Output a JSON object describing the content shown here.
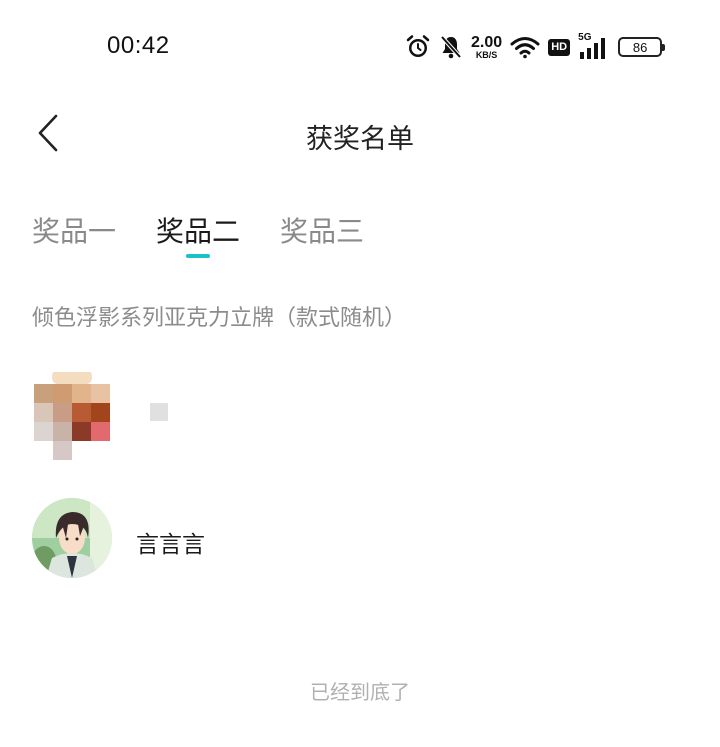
{
  "status_bar": {
    "time": "00:42",
    "net_speed": "2.00",
    "net_speed_unit": "KB/S",
    "hd_label": "HD",
    "signal_label": "5G",
    "battery": "86"
  },
  "nav": {
    "title": "获奖名单"
  },
  "tabs": [
    {
      "label": "奖品一",
      "active": false
    },
    {
      "label": "奖品二",
      "active": true
    },
    {
      "label": "奖品三",
      "active": false
    }
  ],
  "prize": {
    "name": "倾色浮影系列亚克力立牌（款式随机）"
  },
  "winners": [
    {
      "name": ""
    },
    {
      "name": "言言言"
    }
  ],
  "footer": {
    "end_text": "已经到底了"
  },
  "colors": {
    "accent": "#19c1c8",
    "inactive_tab": "#8a8a8a",
    "muted_text": "#8c8c8c",
    "footer_text": "#b0b0b0"
  }
}
